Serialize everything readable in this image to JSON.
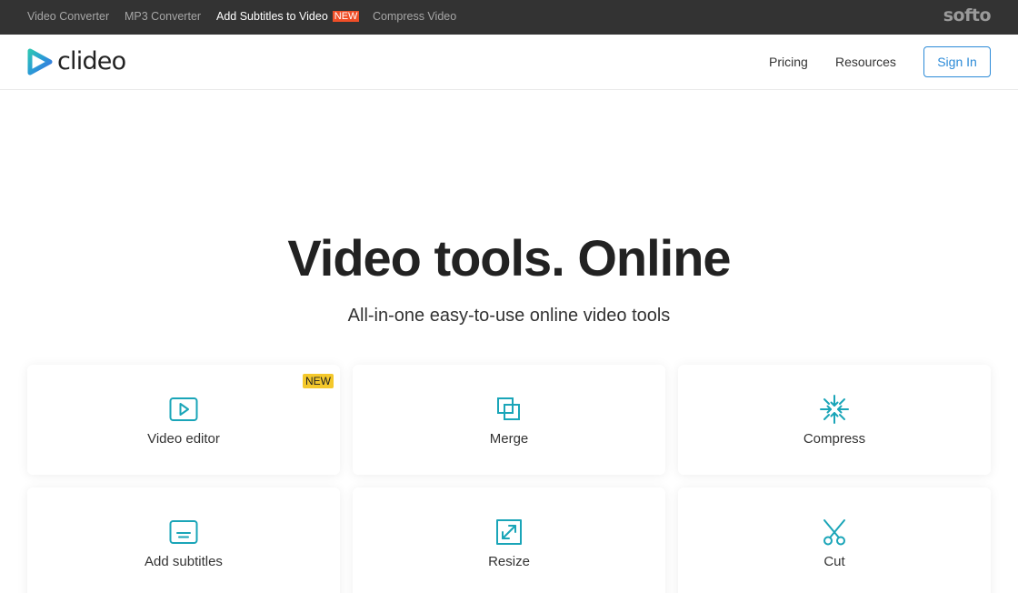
{
  "topbar": {
    "links": [
      "Video Converter",
      "MP3 Converter",
      "Add Subtitles to Video",
      "Compress Video"
    ],
    "new_tag": "NEW",
    "brand": "softo"
  },
  "header": {
    "logo_text": "clideo",
    "nav": [
      "Pricing",
      "Resources"
    ],
    "signin": "Sign In"
  },
  "hero": {
    "title": "Video tools. Online",
    "subtitle": "All-in-one easy-to-use online video tools"
  },
  "tools": [
    {
      "label": "Video editor",
      "icon": "play-icon",
      "badge": "NEW"
    },
    {
      "label": "Merge",
      "icon": "merge-icon"
    },
    {
      "label": "Compress",
      "icon": "compress-icon"
    },
    {
      "label": "Add subtitles",
      "icon": "subtitles-icon"
    },
    {
      "label": "Resize",
      "icon": "resize-icon"
    },
    {
      "label": "Cut",
      "icon": "scissors-icon"
    }
  ],
  "colors": {
    "topbar_bg": "#333333",
    "accent": "#2c8bd8",
    "icon_teal": "#1aa5b8",
    "new_tag": "#ef4e27",
    "badge_yellow": "#f4c82b"
  }
}
